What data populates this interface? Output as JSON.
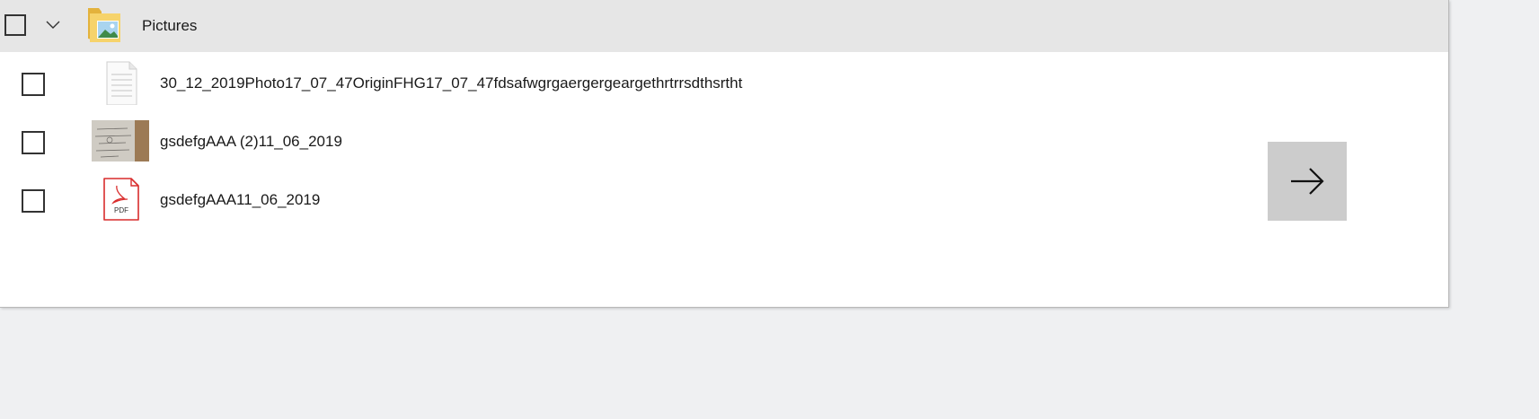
{
  "header": {
    "folder_name": "Pictures",
    "folder_icon": "folder-pictures-icon",
    "expand_icon": "chevron-down-icon"
  },
  "files": [
    {
      "name": "30_12_2019Photo17_07_47OriginFHG17_07_47fdsafwgrgaergergeargethrtrrsdthsrtht",
      "icon": "text-document-icon"
    },
    {
      "name": "gsdefgAAA (2)11_06_2019",
      "icon": "image-thumbnail"
    },
    {
      "name": "gsdefgAAA11_06_2019",
      "icon": "pdf-icon"
    }
  ],
  "actions": {
    "next_icon": "arrow-right-icon"
  },
  "colors": {
    "background": "#eff0f2",
    "header": "#e6e6e6",
    "panel": "#ffffff",
    "next_button": "#cccccc",
    "pdf_red": "#d92c2c"
  }
}
